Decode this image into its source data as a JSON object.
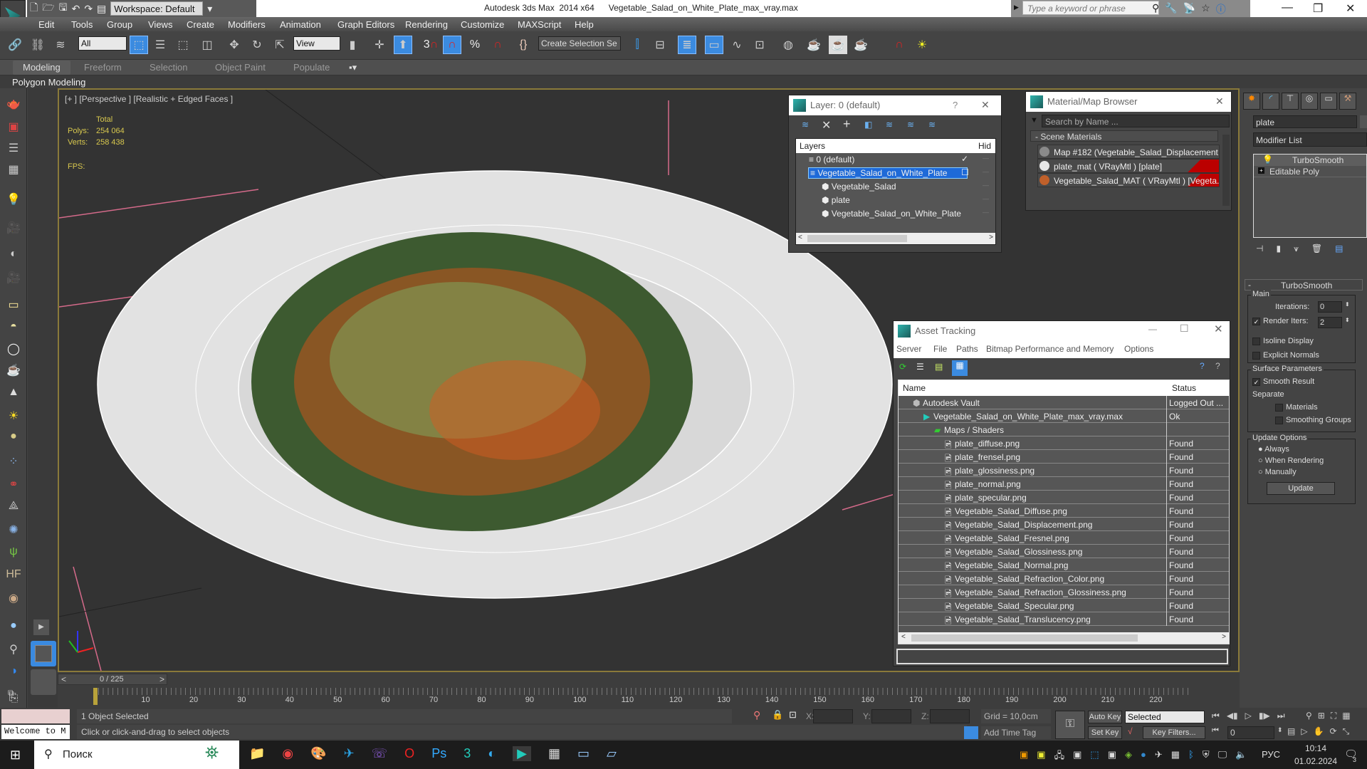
{
  "titlebar": {
    "workspace": "Workspace: Default",
    "app_title": "Autodesk 3ds Max  2014 x64",
    "file_title": "Vegetable_Salad_on_White_Plate_max_vray.max",
    "search_placeholder": "Type a keyword or phrase",
    "minimize": "—",
    "restore": "❐",
    "close": "✕"
  },
  "menu": [
    "Edit",
    "Tools",
    "Group",
    "Views",
    "Create",
    "Modifiers",
    "Animation",
    "Graph Editors",
    "Rendering",
    "Customize",
    "MAXScript",
    "Help"
  ],
  "toolbar": {
    "filter_value": "All",
    "refcoord_value": "View",
    "selection_set_placeholder": "Create Selection Se",
    "snap_label": "3"
  },
  "ribbon": {
    "tabs": [
      "Modeling",
      "Freeform",
      "Selection",
      "Object Paint",
      "Populate"
    ],
    "active_tab": "Modeling",
    "sub_label": "Polygon Modeling"
  },
  "viewport": {
    "label": "[+ ] [Perspective ] [Realistic + Edged Faces ]",
    "stats_header": "Total",
    "polys_label": "Polys:",
    "polys_value": "254 064",
    "verts_label": "Verts:",
    "verts_value": "258 438",
    "fps_label": "FPS:"
  },
  "layer_dialog": {
    "title": "Layer: 0 (default)",
    "help": "?",
    "close": "✕",
    "col_layers": "Layers",
    "col_hide": "Hid",
    "rows": [
      {
        "label": "0 (default)",
        "level": 0,
        "selected": false,
        "check": "✓"
      },
      {
        "label": "Vegetable_Salad_on_White_Plate",
        "level": 0,
        "selected": true,
        "check": "☐"
      },
      {
        "label": "Vegetable_Salad",
        "level": 1,
        "selected": false,
        "check": ""
      },
      {
        "label": "plate",
        "level": 1,
        "selected": false,
        "check": ""
      },
      {
        "label": "Vegetable_Salad_on_White_Plate",
        "level": 1,
        "selected": false,
        "check": ""
      }
    ]
  },
  "material_browser": {
    "title": "Material/Map Browser",
    "close": "✕",
    "search_placeholder": "Search by Name ...",
    "group": "- Scene Materials",
    "items": [
      {
        "label": "Map #182 (Vegetable_Salad_Displacement...",
        "swatch": "#8a8a8a",
        "flag": false
      },
      {
        "label": "plate_mat  ( VRayMtl )  [plate]",
        "swatch": "#e8e8e8",
        "flag": true
      },
      {
        "label": "Vegetable_Salad_MAT  ( VRayMtl )  [Vegeta...",
        "swatch": "#c0602a",
        "flag": true
      }
    ]
  },
  "command_panel": {
    "object_name": "plate",
    "modifier_list": "Modifier List",
    "stack": [
      "TurboSmooth",
      "Editable Poly"
    ],
    "rollout_title": "TurboSmooth",
    "main_group": "Main",
    "iterations_label": "Iterations:",
    "iterations_value": "0",
    "render_iters_label": "Render Iters:",
    "render_iters_value": "2",
    "render_iters_checked": true,
    "isoline_label": "Isoline Display",
    "explicit_normals_label": "Explicit Normals",
    "surface_group": "Surface Parameters",
    "smooth_result_label": "Smooth Result",
    "separate_label": "Separate",
    "materials_label": "Materials",
    "smoothing_groups_label": "Smoothing Groups",
    "update_group": "Update Options",
    "update_options": [
      "Always",
      "When Rendering",
      "Manually"
    ],
    "update_selected": "Always",
    "update_button": "Update"
  },
  "asset_tracking": {
    "title": "Asset Tracking",
    "menu": [
      "Server",
      "File",
      "Paths",
      "Bitmap Performance and Memory",
      "Options"
    ],
    "col_name": "Name",
    "col_status": "Status",
    "rows": [
      {
        "name": "Autodesk Vault",
        "status": "Logged Out ...",
        "level": 0,
        "icon": "vault-icon"
      },
      {
        "name": "Vegetable_Salad_on_White_Plate_max_vray.max",
        "status": "Ok",
        "level": 1,
        "icon": "max-file-icon"
      },
      {
        "name": "Maps / Shaders",
        "status": "",
        "level": 2,
        "icon": "maps-folder-icon"
      },
      {
        "name": "plate_diffuse.png",
        "status": "Found",
        "level": 3,
        "icon": "bitmap-icon"
      },
      {
        "name": "plate_frensel.png",
        "status": "Found",
        "level": 3,
        "icon": "bitmap-icon"
      },
      {
        "name": "plate_glossiness.png",
        "status": "Found",
        "level": 3,
        "icon": "bitmap-icon"
      },
      {
        "name": "plate_normal.png",
        "status": "Found",
        "level": 3,
        "icon": "bitmap-icon"
      },
      {
        "name": "plate_specular.png",
        "status": "Found",
        "level": 3,
        "icon": "bitmap-icon"
      },
      {
        "name": "Vegetable_Salad_Diffuse.png",
        "status": "Found",
        "level": 3,
        "icon": "bitmap-icon"
      },
      {
        "name": "Vegetable_Salad_Displacement.png",
        "status": "Found",
        "level": 3,
        "icon": "bitmap-icon"
      },
      {
        "name": "Vegetable_Salad_Fresnel.png",
        "status": "Found",
        "level": 3,
        "icon": "bitmap-icon"
      },
      {
        "name": "Vegetable_Salad_Glossiness.png",
        "status": "Found",
        "level": 3,
        "icon": "bitmap-icon"
      },
      {
        "name": "Vegetable_Salad_Normal.png",
        "status": "Found",
        "level": 3,
        "icon": "bitmap-icon"
      },
      {
        "name": "Vegetable_Salad_Refraction_Color.png",
        "status": "Found",
        "level": 3,
        "icon": "bitmap-icon"
      },
      {
        "name": "Vegetable_Salad_Refraction_Glossiness.png",
        "status": "Found",
        "level": 3,
        "icon": "bitmap-icon"
      },
      {
        "name": "Vegetable_Salad_Specular.png",
        "status": "Found",
        "level": 3,
        "icon": "bitmap-icon"
      },
      {
        "name": "Vegetable_Salad_Translucency.png",
        "status": "Found",
        "level": 3,
        "icon": "bitmap-icon"
      }
    ]
  },
  "timeline": {
    "frame_counter": "0 / 225",
    "ticks": [
      "10",
      "20",
      "30",
      "40",
      "50",
      "60",
      "70",
      "80",
      "90",
      "100",
      "110",
      "120",
      "130",
      "140",
      "150",
      "160",
      "170",
      "180",
      "190",
      "200",
      "210",
      "220"
    ]
  },
  "status": {
    "maxscript_text": "Welcome to M",
    "selected": "1 Object Selected",
    "prompt": "Click or click-and-drag to select objects",
    "x_label": "X:",
    "y_label": "Y:",
    "z_label": "Z:",
    "grid": "Grid = 10,0cm",
    "add_time_tag": "Add Time Tag",
    "auto_key": "Auto Key",
    "set_key": "Set Key",
    "key_mode": "Selected",
    "key_filters": "Key Filters...",
    "frame_value": "0"
  },
  "taskbar": {
    "search": "Поиск",
    "lang": "РУС",
    "time": "10:14",
    "date": "01.02.2024",
    "notifications": "3"
  }
}
